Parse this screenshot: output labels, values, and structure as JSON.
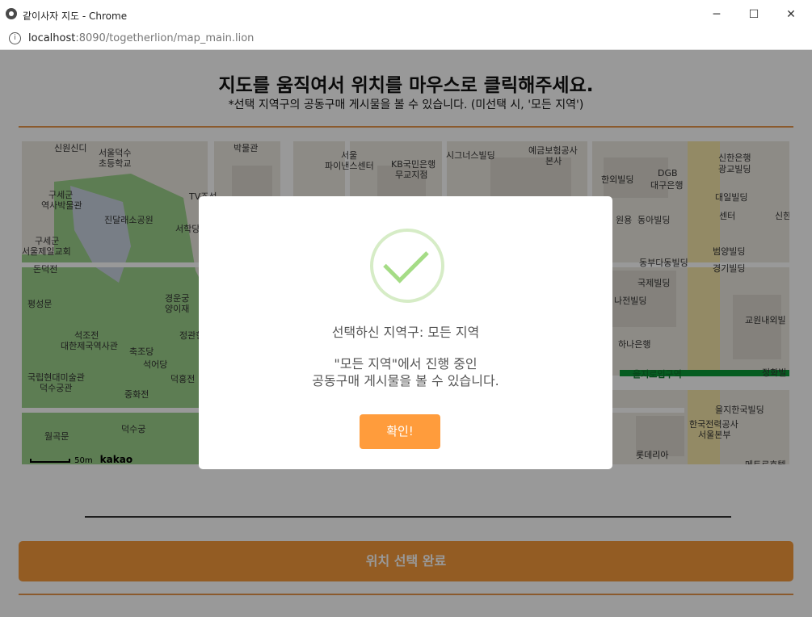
{
  "browser": {
    "tab_title": "같이사자 지도 - Chrome",
    "url_host": "localhost",
    "url_path": ":8090/togetherlion/map_main.lion",
    "info_icon": "i",
    "minimize_icon": "─",
    "maximize_icon": "☐",
    "close_icon": "✕"
  },
  "page": {
    "heading": "지도를 움직여서 위치를 마우스로 클릭해주세요.",
    "subheading": "*선택 지역구의 공동구매 게시물을 볼 수 있습니다. (미선택 시, '모든 지역')",
    "complete_button": "위치 선택 완료"
  },
  "map": {
    "labels": [
      "신원신디",
      "서울덕수",
      "초등학교",
      "박물관",
      "서울",
      "파이낸스센터",
      "KB국민은행",
      "무교지점",
      "시그너스빌딩",
      "예금보험공사",
      "본사",
      "한외빌딩",
      "DGB",
      "대구은행",
      "신한은행",
      "광교빌딩",
      "구세군",
      "역사박물관",
      "진달래소공원",
      "TV조선",
      "서학당",
      "대일빌딩",
      "원용",
      "동아빌딩",
      "센터",
      "신한",
      "구세군",
      "서울제일교회",
      "돈덕전",
      "범양빌딩",
      "동부다동빌딩",
      "경기빌딩",
      "국제빌딩",
      "평성문",
      "경운궁",
      "양이재",
      "나전빌딩",
      "교원내외빌",
      "석조전",
      "대한제국역사관",
      "정관헌",
      "하나은행",
      "축조당",
      "석어당",
      "을지로입구역",
      "정화빌",
      "국립현대미술관",
      "덕수궁관",
      "덕홍전",
      "중화전",
      "을지한국빌딩",
      "덕수궁",
      "한국전력공사",
      "서울본부",
      "월곡문",
      "롯데리아",
      "메트로호텔"
    ],
    "scale_text": "50m",
    "brand": "kakao",
    "subway_station": "을지로입구역",
    "colors": {
      "park": "#9bd08a",
      "road": "#ffffff",
      "main_road": "#f5e6a8",
      "subway_line": "#0a9a37"
    }
  },
  "modal": {
    "icon": "success-check-icon",
    "title": "선택하신 지역구: 모든 지역",
    "message_line1": "\"모든 지역\"에서 진행 중인",
    "message_line2": "공동구매 게시물을 볼 수 있습니다.",
    "confirm_button": "확인!",
    "colors": {
      "confirm": "#ff9c3c",
      "check": "#a5dc86"
    }
  }
}
